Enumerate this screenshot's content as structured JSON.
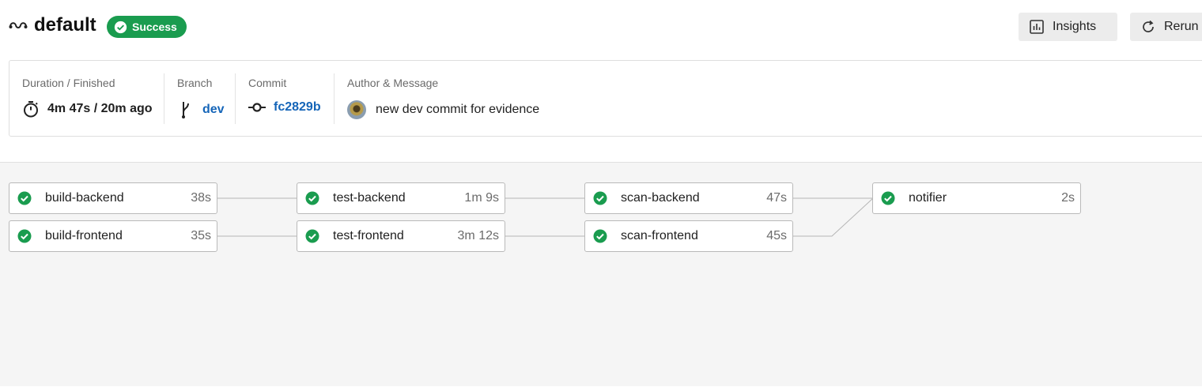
{
  "header": {
    "icon": "pipeline-icon",
    "title": "default",
    "status": "Success",
    "status_color": "#1a9c4f",
    "insights_label": "Insights",
    "rerun_label": "Rerun"
  },
  "info": {
    "duration_label": "Duration / Finished",
    "duration_value": "4m 47s / 20m ago",
    "branch_label": "Branch",
    "branch_value": "dev",
    "commit_label": "Commit",
    "commit_value": "fc2829b",
    "author_label": "Author & Message",
    "message": "new dev commit for evidence"
  },
  "jobs": {
    "build_backend": {
      "name": "build-backend",
      "duration": "38s",
      "status": "success"
    },
    "build_frontend": {
      "name": "build-frontend",
      "duration": "35s",
      "status": "success"
    },
    "test_backend": {
      "name": "test-backend",
      "duration": "1m 9s",
      "status": "success"
    },
    "test_frontend": {
      "name": "test-frontend",
      "duration": "3m 12s",
      "status": "success"
    },
    "scan_backend": {
      "name": "scan-backend",
      "duration": "47s",
      "status": "success"
    },
    "scan_frontend": {
      "name": "scan-frontend",
      "duration": "45s",
      "status": "success"
    },
    "notifier": {
      "name": "notifier",
      "duration": "2s",
      "status": "success"
    }
  },
  "colors": {
    "success": "#1a9c4f",
    "link": "#1565b8"
  }
}
